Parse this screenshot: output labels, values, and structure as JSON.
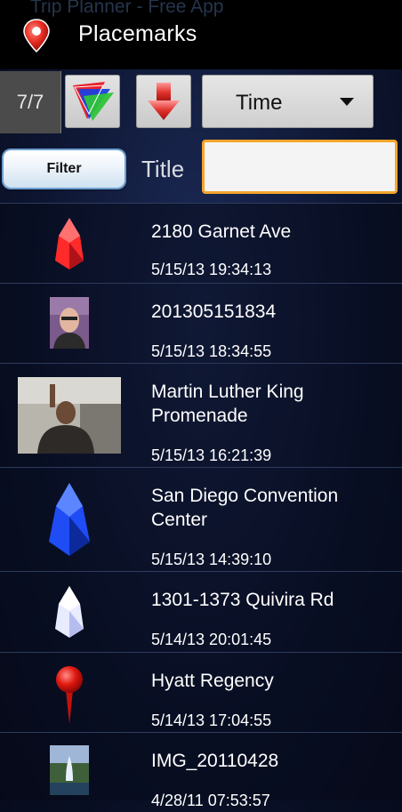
{
  "app": {
    "title": "Placemarks",
    "background_caption": "Trip Planner - Free App"
  },
  "toolbar": {
    "count": "7/7",
    "sort": {
      "selected": "Time"
    }
  },
  "filter": {
    "button_label": "Filter",
    "field_label": "Title",
    "input_value": "",
    "input_placeholder": ""
  },
  "placemarks": [
    {
      "name": "2180 Garnet Ave",
      "time": "5/15/13 19:34:13",
      "icon": "red-crystal-icon"
    },
    {
      "name": "201305151834",
      "time": "5/15/13 18:34:55",
      "icon": "portrait-photo"
    },
    {
      "name": "Martin Luther King Promenade",
      "time": "5/15/13 16:21:39",
      "icon": "street-photo"
    },
    {
      "name": "San Diego Convention Center",
      "time": "5/15/13 14:39:10",
      "icon": "blue-crystal-icon"
    },
    {
      "name": "1301-1373 Quivira Rd",
      "time": "5/14/13 20:01:45",
      "icon": "white-crystal-icon"
    },
    {
      "name": "Hyatt Regency",
      "time": "5/14/13 17:04:55",
      "icon": "red-pin-icon"
    },
    {
      "name": "IMG_20110428",
      "time": "4/28/11 07:53:57",
      "icon": "fountain-photo"
    }
  ],
  "colors": {
    "accent_orange": "#f4a52b",
    "filter_blue": "#6e9fd0",
    "red_marker": "#e8232b",
    "blue_marker": "#1e4ff0"
  }
}
